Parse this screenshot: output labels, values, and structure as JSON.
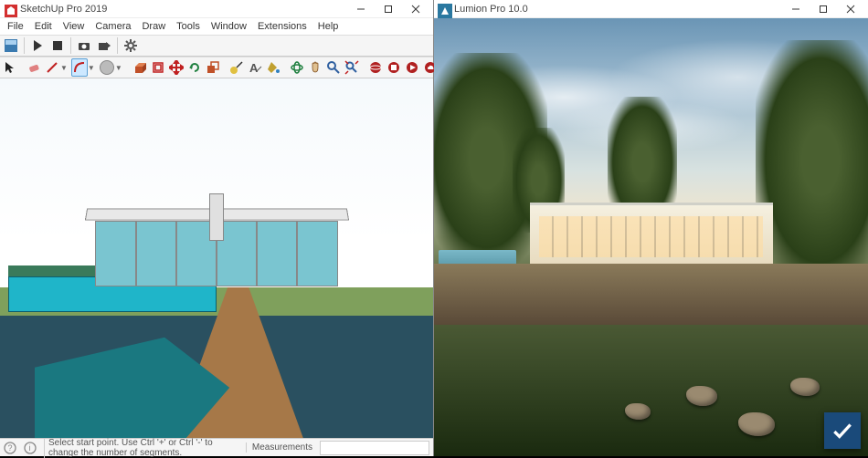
{
  "left": {
    "title": "SketchUp Pro 2019",
    "menus": [
      "File",
      "Edit",
      "View",
      "Camera",
      "Draw",
      "Tools",
      "Window",
      "Extensions",
      "Help"
    ],
    "toolbar1": {
      "styles_label": "Styles",
      "play_label": "Play",
      "stop_label": "Stop"
    },
    "status": {
      "hint": "Select start point. Use Ctrl '+' or Ctrl '-' to change the number of segments.",
      "measure_label": "Measurements"
    }
  },
  "right": {
    "title": "Lumion Pro 10.0"
  }
}
